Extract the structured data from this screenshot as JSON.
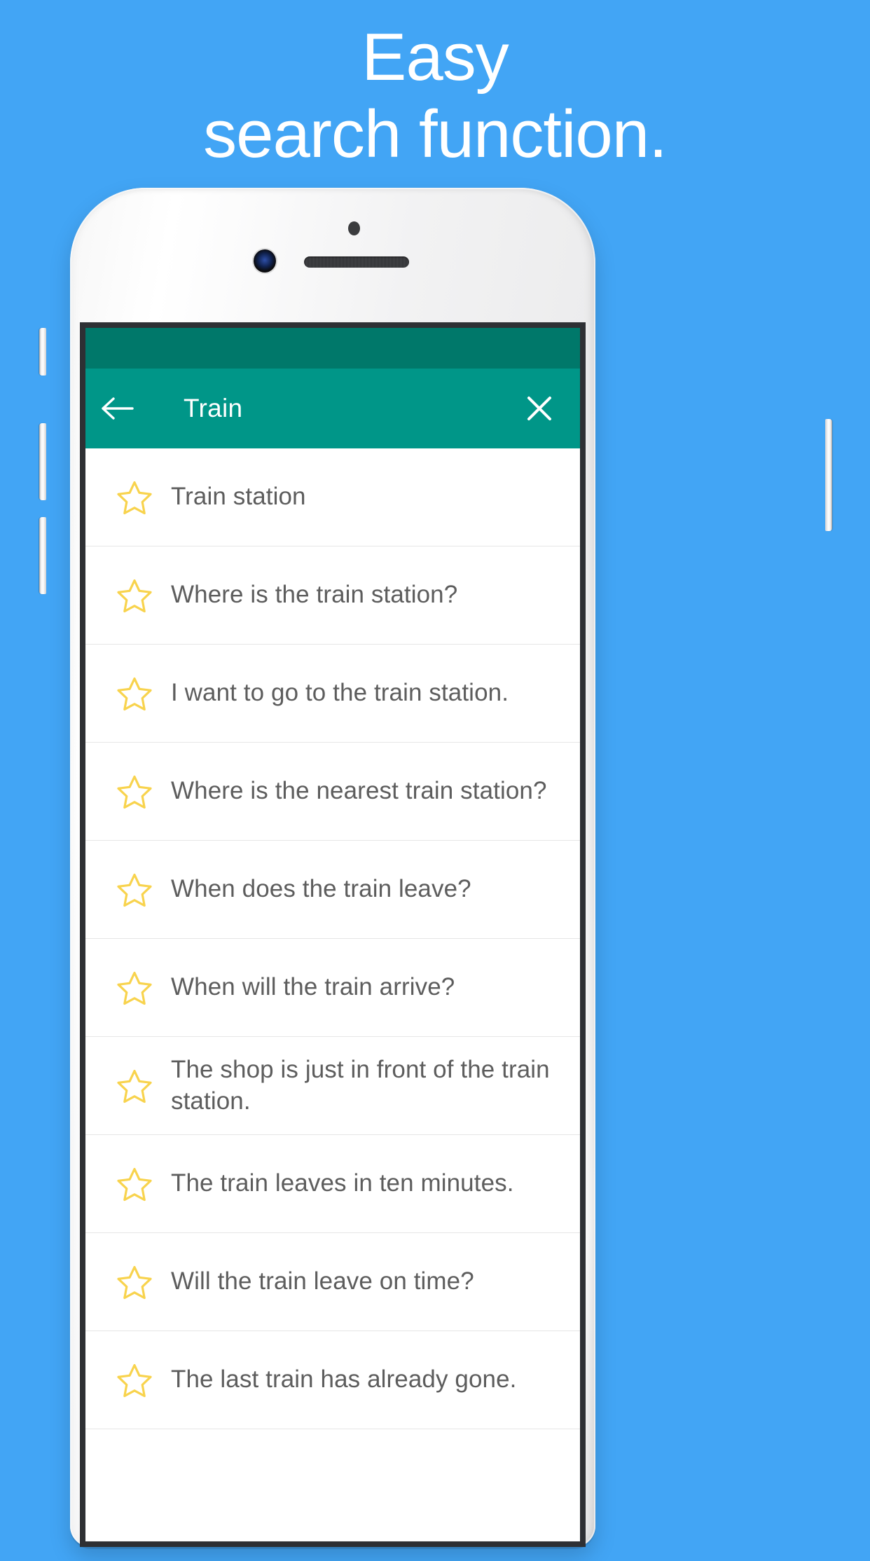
{
  "promo": {
    "headline_line1": "Easy",
    "headline_line2": "search function.",
    "background_color": "#42a5f5",
    "headline_color": "#ffffff"
  },
  "device": {
    "name": "white-smartphone-mockup",
    "body_color": "#f2f2f3",
    "bezel_color": "#2e3034",
    "hardware": {
      "earpiece_speaker": "speaker-grille",
      "front_camera": "front-camera",
      "proximity_sensor": "sensor-dot",
      "left_buttons": [
        "mute-switch",
        "volume-up-button",
        "volume-down-button"
      ],
      "right_buttons": [
        "power-button"
      ]
    }
  },
  "app": {
    "statusbar": {
      "color": "#00786a"
    },
    "toolbar": {
      "color": "#009688",
      "title": "Train",
      "title_color": "#ffffff",
      "back_icon": "arrow-left-icon",
      "close_icon": "close-icon"
    },
    "list": {
      "star_icon": "star-outline-icon",
      "star_color": "#f8d34d",
      "text_color": "#5d5d5d",
      "divider_color": "#e6e6e6",
      "items": [
        {
          "text": "Train station",
          "favorited": false
        },
        {
          "text": "Where is the train station?",
          "favorited": false
        },
        {
          "text": "I want to go to the train station.",
          "favorited": false
        },
        {
          "text": "Where is the nearest train station?",
          "favorited": false
        },
        {
          "text": "When does the train leave?",
          "favorited": false
        },
        {
          "text": "When will the train arrive?",
          "favorited": false
        },
        {
          "text": "The shop is just in front of the train station.",
          "favorited": false
        },
        {
          "text": "The train leaves in ten minutes.",
          "favorited": false
        },
        {
          "text": "Will the train leave on time?",
          "favorited": false
        },
        {
          "text": "The last train has already gone.",
          "favorited": false
        }
      ]
    }
  }
}
